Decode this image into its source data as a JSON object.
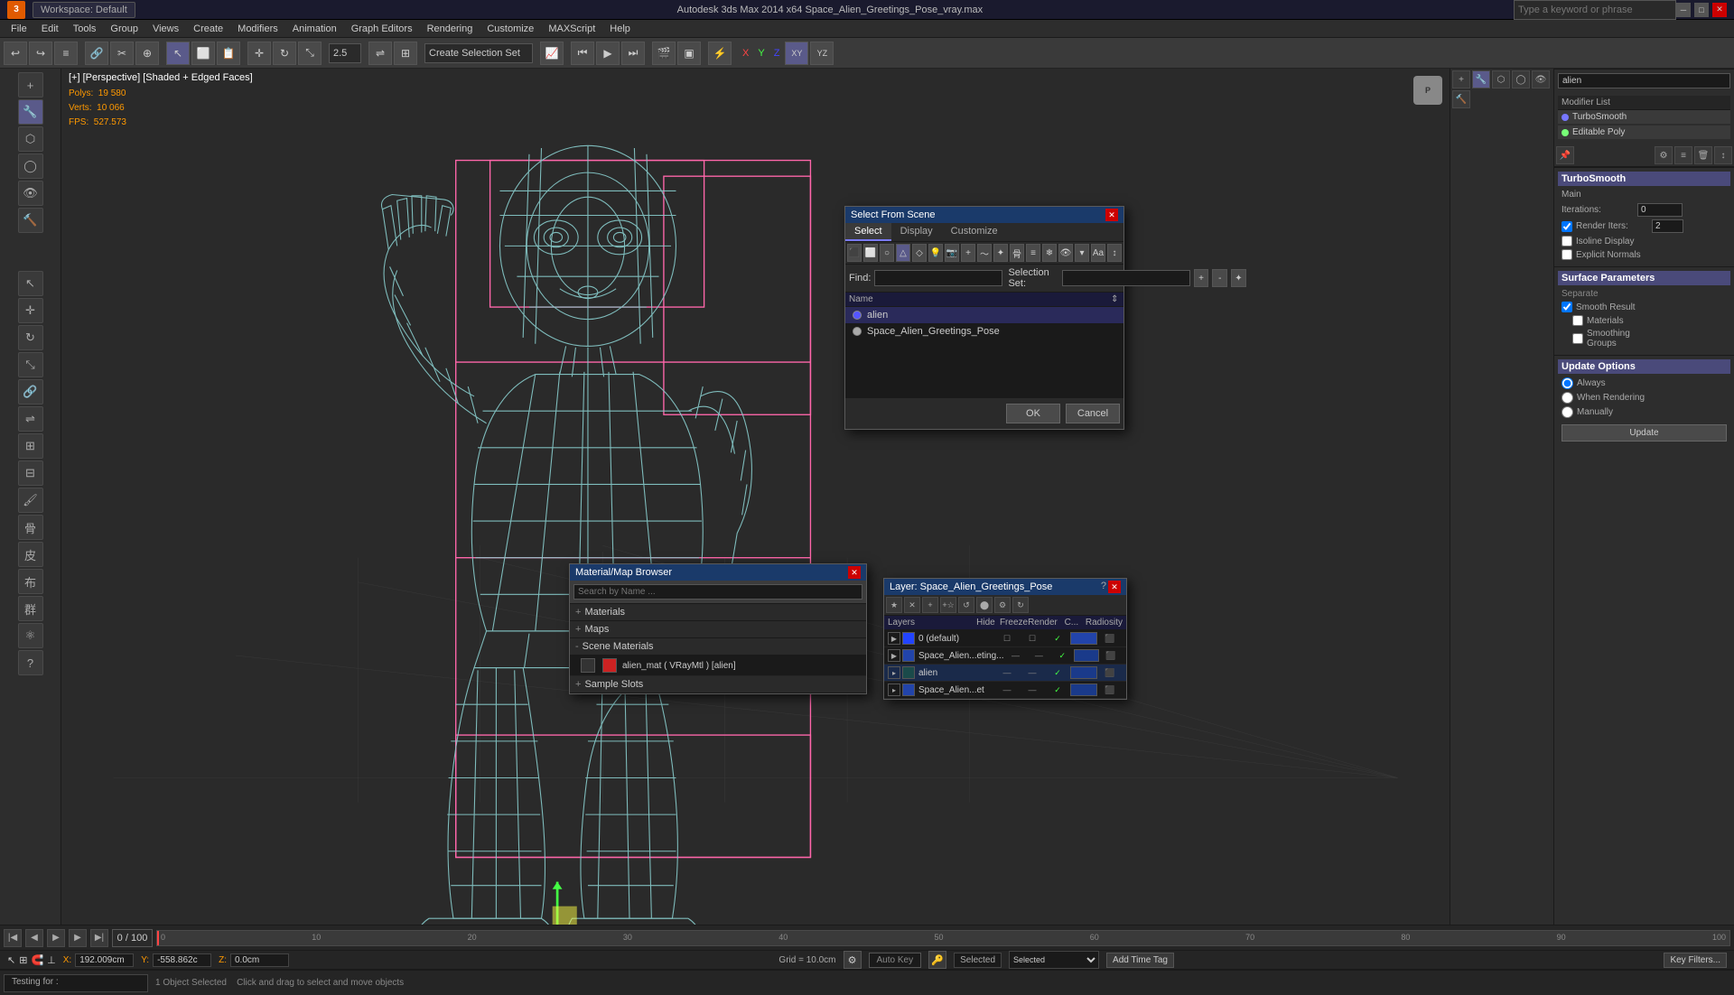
{
  "titlebar": {
    "logo": "3",
    "workspace_label": "Workspace: Default",
    "title": "Autodesk 3ds Max 2014 x64   Space_Alien_Greetings_Pose_vray.max",
    "search_placeholder": "Type a keyword or phrase",
    "win_controls": [
      "─",
      "□",
      "✕"
    ]
  },
  "menubar": {
    "items": [
      "File",
      "Edit",
      "Tools",
      "Group",
      "Views",
      "Create",
      "Modifiers",
      "Animation",
      "Graph Editors",
      "Rendering",
      "Customize",
      "MAXScript",
      "Help"
    ]
  },
  "viewport": {
    "label": "[+] [Perspective] [Shaded + Edged Faces]",
    "stats": {
      "polys_label": "Polys:",
      "polys_val": "19 580",
      "verts_label": "Verts:",
      "verts_val": "10 066",
      "fps_label": "FPS:",
      "fps_val": "527.573"
    }
  },
  "select_from_scene": {
    "title": "Select From Scene",
    "tabs": [
      "Select",
      "Display",
      "Customize"
    ],
    "find_label": "Find:",
    "selection_set_label": "Selection Set:",
    "name_header": "Name",
    "items": [
      {
        "name": "alien",
        "selected": true
      },
      {
        "name": "Space_Alien_Greetings_Pose",
        "selected": false
      }
    ],
    "ok_label": "OK",
    "cancel_label": "Cancel"
  },
  "material_browser": {
    "title": "Material/Map Browser",
    "search_placeholder": "Search by Name ...",
    "sections": [
      "+ Materials",
      "+ Maps",
      "- Scene Materials",
      "+ Sample Slots"
    ],
    "scene_materials": [
      {
        "name": "alien_mat ( VRayMtl ) [alien]"
      }
    ]
  },
  "layer_dialog": {
    "title": "Layer: Space_Alien_Greetings_Pose",
    "headers": [
      "Layers",
      "Hide",
      "Freeze",
      "Render",
      "C...",
      "Radiosity"
    ],
    "layers": [
      {
        "name": "0 (default)",
        "hide": false,
        "freeze": false,
        "render": true
      },
      {
        "name": "Space_Alien...eting...",
        "hide": false,
        "freeze": false,
        "render": true
      },
      {
        "name": "alien",
        "hide": false,
        "freeze": false,
        "render": true
      },
      {
        "name": "Space_Alien...et",
        "hide": false,
        "freeze": false,
        "render": true
      }
    ]
  },
  "modifier_list": {
    "label": "Modifier List",
    "modifiers": [
      "TurboSmooth",
      "Editable Poly"
    ]
  },
  "turbosmooth": {
    "title": "TurboSmooth",
    "main_label": "Main",
    "iterations_label": "Iterations:",
    "iterations_val": "0",
    "render_iters_label": "Render Iters:",
    "render_iters_val": "2",
    "isoline_label": "Isoline Display",
    "explicit_normals_label": "Explicit Normals",
    "surface_label": "Surface Parameters",
    "separate_label": "Separate",
    "smooth_result_label": "Smooth Result",
    "materials_label": "Materials",
    "smoothing_groups_label": "Smoothing Groups",
    "update_label": "Update Options",
    "always_label": "Always",
    "when_rendering_label": "When Rendering",
    "manually_label": "Manually",
    "update_btn": "Update"
  },
  "status_bar": {
    "prompt": "Testing for :",
    "object_selected": "1 Object Selected",
    "instructions": "Click and drag to select and move objects",
    "coords": {
      "x_label": "X:",
      "x_val": "192.009cm",
      "y_label": "Y:",
      "y_val": "-558.862c",
      "z_label": "Z:",
      "z_val": "0.0cm"
    },
    "grid_label": "Grid = 10.0cm",
    "autokey_label": "Auto Key",
    "selected_label": "Selected",
    "addtimetag_label": "Add Time Tag",
    "keyfilt_label": "Key Filters..."
  },
  "timeline": {
    "current": "0",
    "end": "100",
    "markers": [
      0,
      10,
      20,
      30,
      40,
      50,
      60,
      70,
      80,
      90,
      100
    ]
  },
  "nav_cube": "P"
}
